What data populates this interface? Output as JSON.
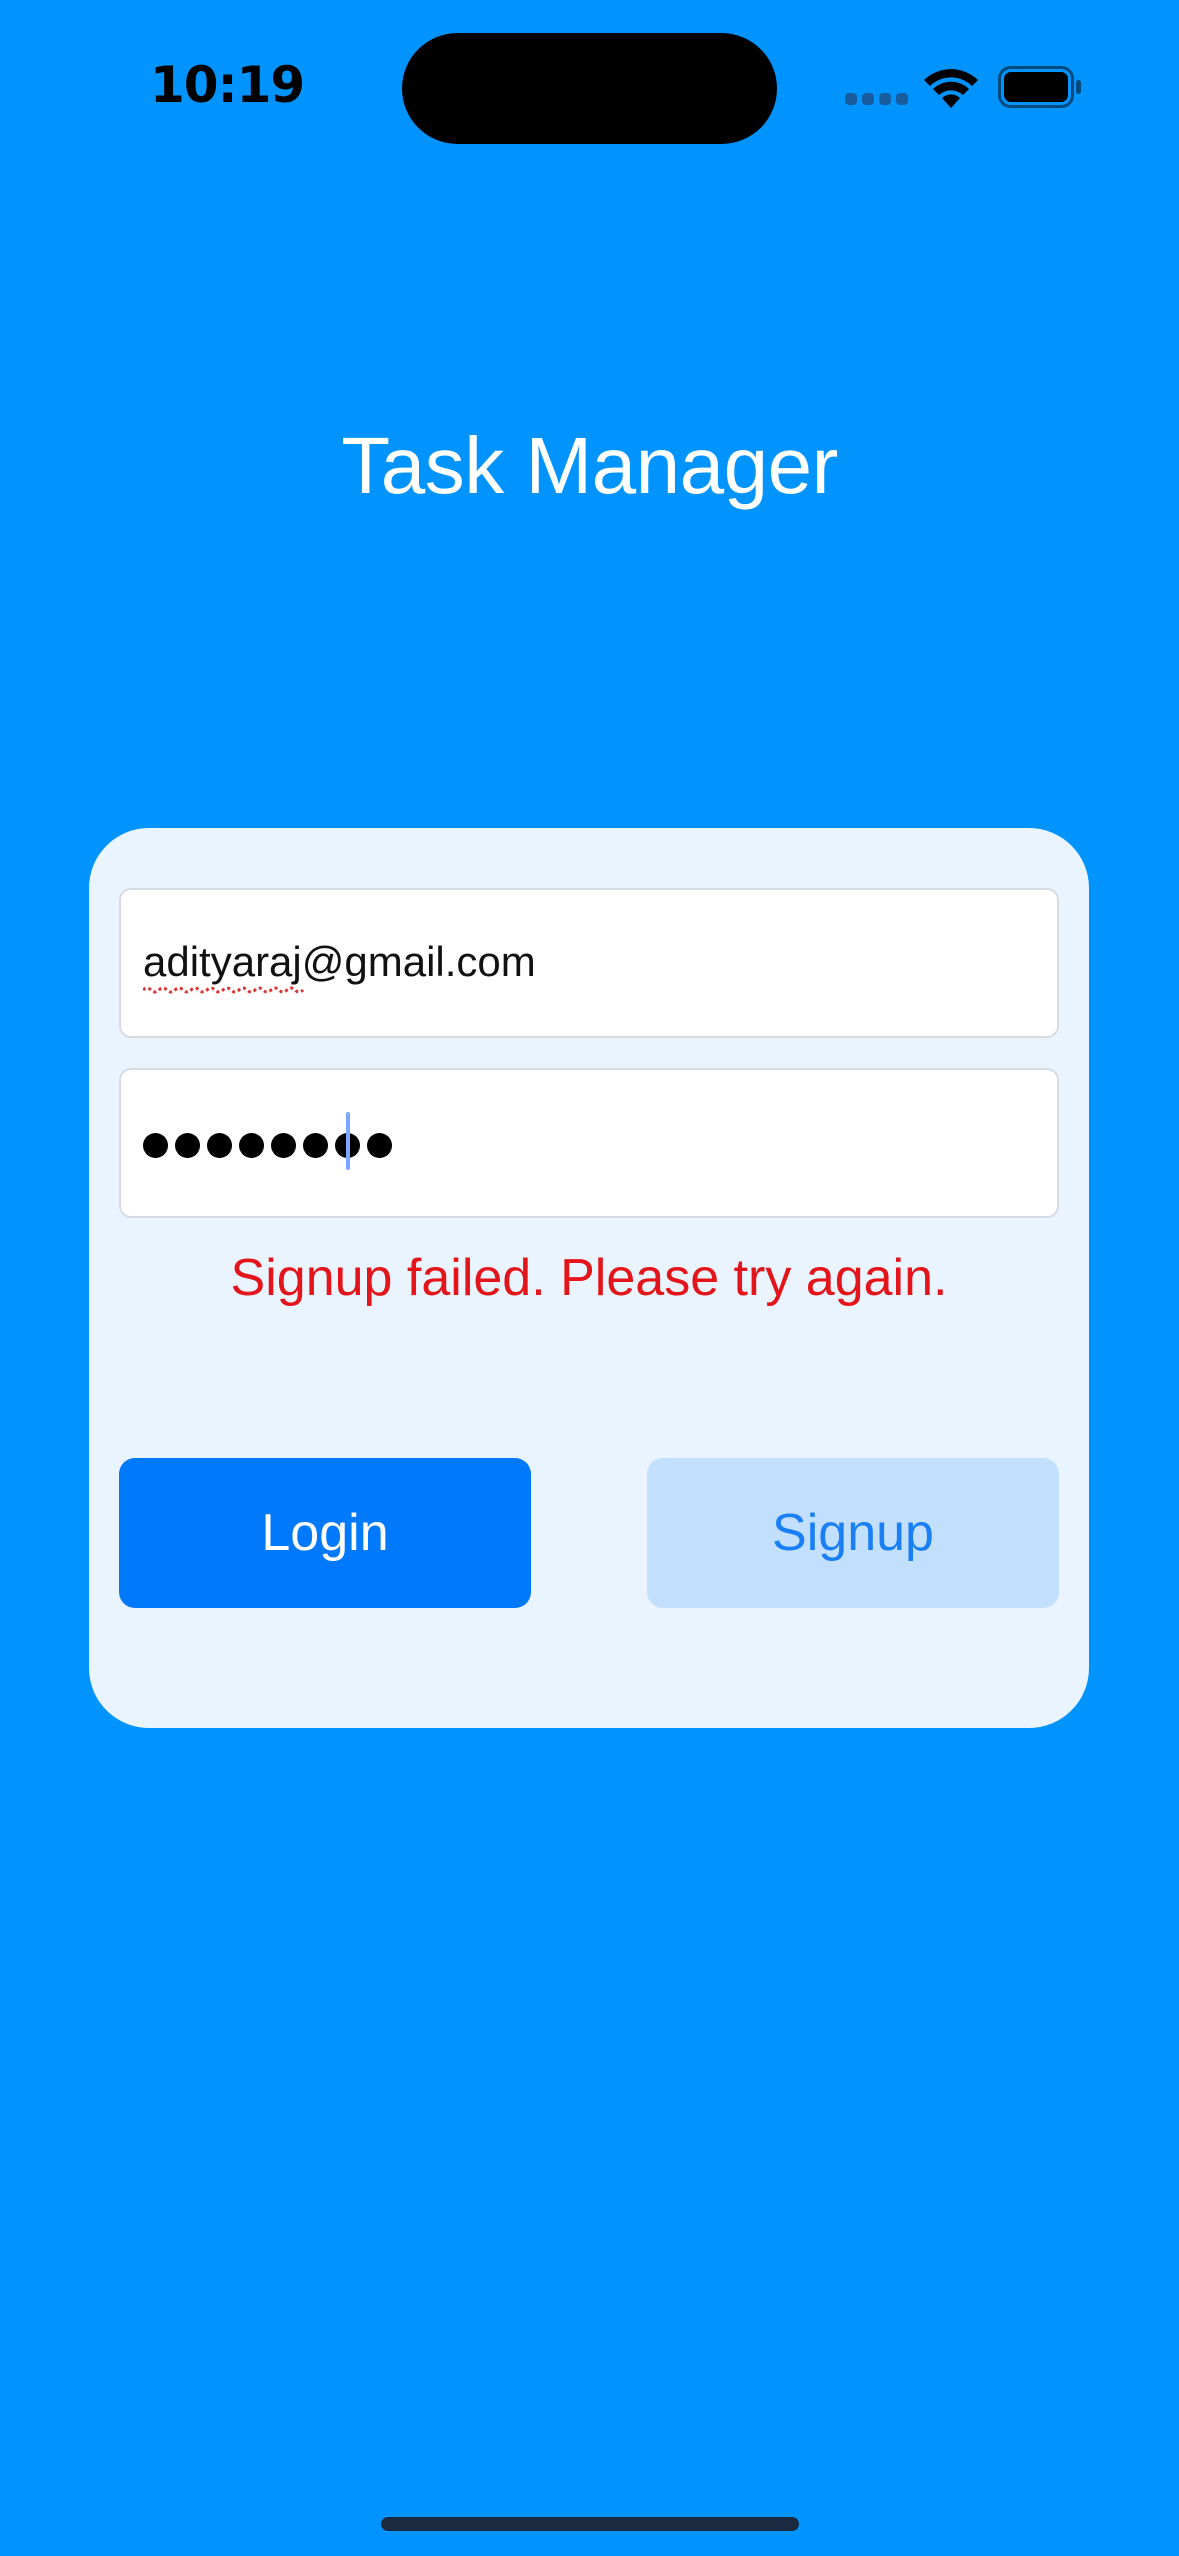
{
  "status_bar": {
    "time": "10:19"
  },
  "app": {
    "title": "Task Manager"
  },
  "form": {
    "email_value": "adityaraj@gmail.com",
    "password_masked_length": 8,
    "error_message": "Signup failed. Please try again."
  },
  "buttons": {
    "login_label": "Login",
    "signup_label": "Signup"
  },
  "icons": {
    "signal": "cellular-signal-icon",
    "wifi": "wifi-icon",
    "battery": "battery-icon"
  },
  "colors": {
    "background": "#0194FE",
    "card": "#E9F4FF",
    "login_button": "#0179FD",
    "signup_button": "#C2E0FE",
    "error": "#E3151A"
  }
}
